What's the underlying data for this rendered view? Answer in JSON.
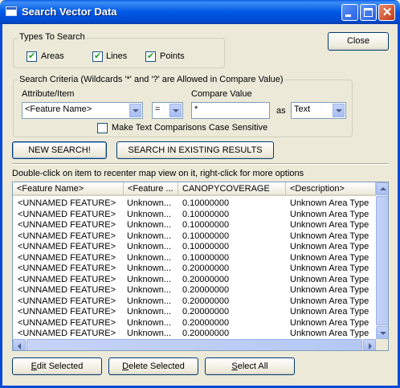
{
  "window": {
    "title": "Search Vector Data"
  },
  "types_group": {
    "label": "Types To Search",
    "areas": "Areas",
    "lines": "Lines",
    "points": "Points"
  },
  "close_button": "Close",
  "criteria_group": {
    "label": "Search Criteria (Wildcards '*' and '?' are Allowed in Compare Value)",
    "attribute_label": "Attribute/Item",
    "attribute_value": "<Feature Name>",
    "operator_value": "=",
    "compare_label": "Compare Value",
    "compare_value": "*",
    "as_label": "as",
    "as_value": "Text",
    "case_sensitive_label": "Make Text Comparisons Case Sensitive"
  },
  "actions": {
    "new_search": "NEW SEARCH!",
    "search_existing": "SEARCH IN EXISTING RESULTS"
  },
  "instructions": "Double-click on item to recenter map view on it, right-click for more options",
  "results": {
    "columns": [
      "<Feature Name>",
      "<Feature ...",
      "CANOPYCOVERAGE",
      "<Description>"
    ],
    "rows": [
      [
        "<UNNAMED FEATURE>",
        "Unknown...",
        "0.10000000",
        "Unknown Area Type"
      ],
      [
        "<UNNAMED FEATURE>",
        "Unknown...",
        "0.10000000",
        "Unknown Area Type"
      ],
      [
        "<UNNAMED FEATURE>",
        "Unknown...",
        "0.10000000",
        "Unknown Area Type"
      ],
      [
        "<UNNAMED FEATURE>",
        "Unknown...",
        "0.10000000",
        "Unknown Area Type"
      ],
      [
        "<UNNAMED FEATURE>",
        "Unknown...",
        "0.10000000",
        "Unknown Area Type"
      ],
      [
        "<UNNAMED FEATURE>",
        "Unknown...",
        "0.10000000",
        "Unknown Area Type"
      ],
      [
        "<UNNAMED FEATURE>",
        "Unknown...",
        "0.20000000",
        "Unknown Area Type"
      ],
      [
        "<UNNAMED FEATURE>",
        "Unknown...",
        "0.20000000",
        "Unknown Area Type"
      ],
      [
        "<UNNAMED FEATURE>",
        "Unknown...",
        "0.20000000",
        "Unknown Area Type"
      ],
      [
        "<UNNAMED FEATURE>",
        "Unknown...",
        "0.20000000",
        "Unknown Area Type"
      ],
      [
        "<UNNAMED FEATURE>",
        "Unknown...",
        "0.20000000",
        "Unknown Area Type"
      ],
      [
        "<UNNAMED FEATURE>",
        "Unknown...",
        "0.20000000",
        "Unknown Area Type"
      ],
      [
        "<UNNAMED FEATURE>",
        "Unknown...",
        "0.20000000",
        "Unknown Area Type"
      ]
    ]
  },
  "bottom_buttons": {
    "edit_key": "E",
    "edit_rest": "dit Selected",
    "delete_key": "D",
    "delete_rest": "elete Selected",
    "select_key": "S",
    "select_rest": "elect All"
  }
}
